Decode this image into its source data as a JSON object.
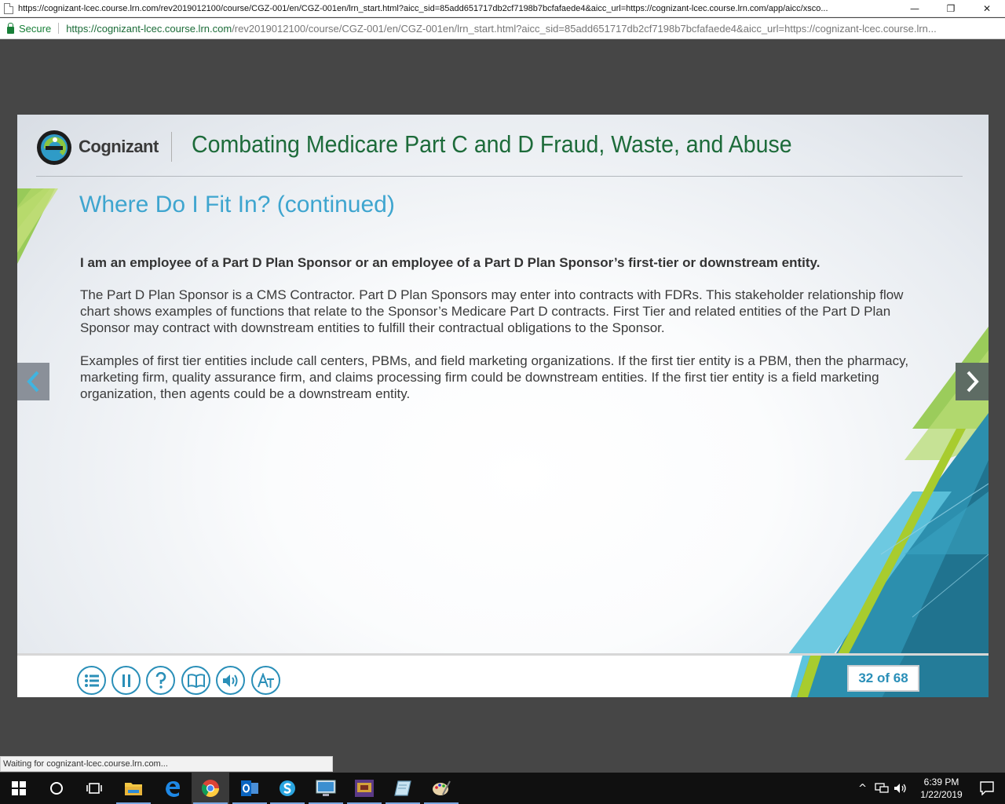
{
  "browser": {
    "title": "https://cognizant-lcec.course.lrn.com/rev2019012100/course/CGZ-001/en/CGZ-001en/lrn_start.html?aicc_sid=85add651717db2cf7198b7bcfafaede4&aicc_url=https://cognizant-lcec.course.lrn.com/app/aicc/xsco...",
    "secure_label": "Secure",
    "url_host": "https://cognizant-lcec.course.lrn.com",
    "url_rest": "/rev2019012100/course/CGZ-001/en/CGZ-001en/lrn_start.html?aicc_sid=85add651717db2cf7198b7bcfafaede4&aicc_url=https://cognizant-lcec.course.lrn...",
    "minimize": "—",
    "restore": "❐",
    "close": "✕",
    "status": "Waiting for cognizant-lcec.course.lrn.com..."
  },
  "slide": {
    "logo_text": "Cognizant",
    "course_title": "Combating Medicare Part C and D Fraud, Waste, and Abuse",
    "heading": "Where Do I Fit In? (continued)",
    "lead": "I am an employee of a Part D Plan Sponsor or an employee of a Part D Plan Sponsor’s first-tier or downstream entity.",
    "paragraph1": "The Part D Plan Sponsor is a CMS Contractor. Part D Plan Sponsors may enter into contracts with FDRs. This stakeholder relationship flow chart shows examples of functions that relate to the Sponsor’s Medicare Part D contracts. First Tier and related entities of the Part D Plan Sponsor may contract with downstream entities to fulfill their contractual obligations to the Sponsor.",
    "paragraph2": "Examples of first tier entities include call centers, PBMs, and field marketing organizations. If the first tier entity is a PBM, then the pharmacy, marketing firm, quality assurance firm, and claims processing firm could be downstream entities. If the first tier entity is a field marketing organization, then agents could be a downstream entity.",
    "page_counter": "32 of 68",
    "controls": [
      "menu-icon",
      "pause-icon",
      "help-icon",
      "glossary-book-icon",
      "audio-icon",
      "transcript-text-icon"
    ]
  },
  "taskbar": {
    "time": "6:39 PM",
    "date": "1/22/2019"
  },
  "colors": {
    "heading": "#3ea5cf",
    "course_title": "#1d6b3a",
    "control": "#2a8fb8",
    "accent_green": "#8cc63f",
    "accent_teal": "#2c8fae"
  }
}
